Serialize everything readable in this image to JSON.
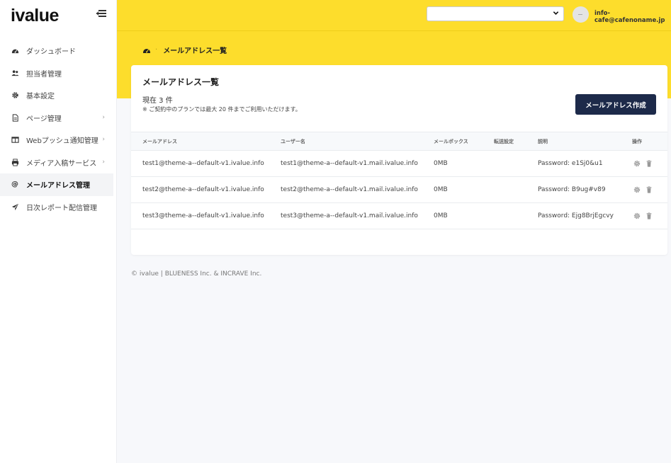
{
  "app": {
    "logo": "ivalue"
  },
  "header": {
    "select_value": "",
    "user_email": "info-cafe@cafenoname.jp"
  },
  "sidebar": {
    "items": [
      {
        "label": "ダッシュボード",
        "icon": "dashboard-icon"
      },
      {
        "label": "担当者管理",
        "icon": "users-icon"
      },
      {
        "label": "基本設定",
        "icon": "gear-icon"
      },
      {
        "label": "ページ管理",
        "icon": "file-icon",
        "has_children": true
      },
      {
        "label": "Webプッシュ通知管理",
        "icon": "window-icon",
        "has_children": true
      },
      {
        "label": "メディア入稿サービス",
        "icon": "printer-icon",
        "has_children": true
      },
      {
        "label": "メールアドレス管理",
        "icon": "at-icon",
        "active": true
      },
      {
        "label": "日次レポート配信管理",
        "icon": "paper-plane-icon"
      }
    ]
  },
  "breadcrumb": {
    "current": "メールアドレス一覧"
  },
  "main": {
    "title": "メールアドレス一覧",
    "count_text": "現在 3 件",
    "note_text": "※ ご契約中のプランでは最大 20 件までご利用いただけます。",
    "create_button": "メールアドレス作成"
  },
  "table": {
    "headers": [
      "メールアドレス",
      "ユーザー名",
      "メールボックス",
      "転送設定",
      "説明",
      "操作"
    ],
    "rows": [
      {
        "email": "test1@theme-a--default-v1.ivalue.info",
        "username": "test1@theme-a--default-v1.mail.ivalue.info",
        "mailbox": "0MB",
        "forward": "",
        "description": "Password: e1Sj0&u1"
      },
      {
        "email": "test2@theme-a--default-v1.ivalue.info",
        "username": "test2@theme-a--default-v1.mail.ivalue.info",
        "mailbox": "0MB",
        "forward": "",
        "description": "Password: B9ug#v89"
      },
      {
        "email": "test3@theme-a--default-v1.ivalue.info",
        "username": "test3@theme-a--default-v1.mail.ivalue.info",
        "mailbox": "0MB",
        "forward": "",
        "description": "Password: Ejg8BrjEgcvy"
      }
    ]
  },
  "footer": {
    "text": "© ivalue | BLUENESS Inc. & INCRAVE Inc."
  },
  "colors": {
    "header_yellow": "#fddd2c",
    "primary_button": "#1d2a4a"
  }
}
